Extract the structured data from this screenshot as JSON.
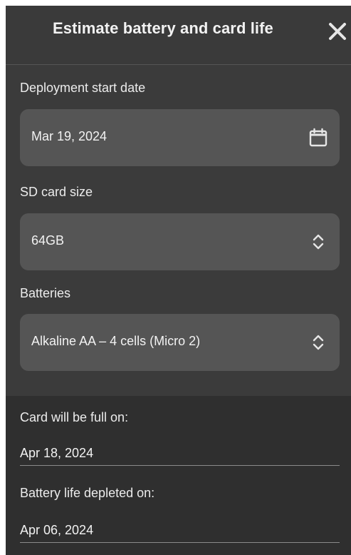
{
  "header": {
    "title": "Estimate battery and card life",
    "close_icon": "close-icon"
  },
  "form": {
    "start_date": {
      "label": "Deployment start date",
      "value": "Mar 19, 2024",
      "icon": "calendar-icon"
    },
    "sd_card": {
      "label": "SD card size",
      "value": "64GB",
      "icon": "chevron-up-down-icon"
    },
    "batteries": {
      "label": "Batteries",
      "value": "Alkaline AA – 4 cells (Micro 2)",
      "icon": "chevron-up-down-icon"
    }
  },
  "results": {
    "card_full": {
      "label": "Card will be full on:",
      "value": "Apr 18, 2024"
    },
    "battery_depleted": {
      "label": "Battery life depleted on:",
      "value": "Apr 06, 2024"
    }
  },
  "colors": {
    "background": "#3a3a3a",
    "field": "#555555",
    "results_background": "#2f2f2f",
    "text": "#f2f2f2"
  }
}
